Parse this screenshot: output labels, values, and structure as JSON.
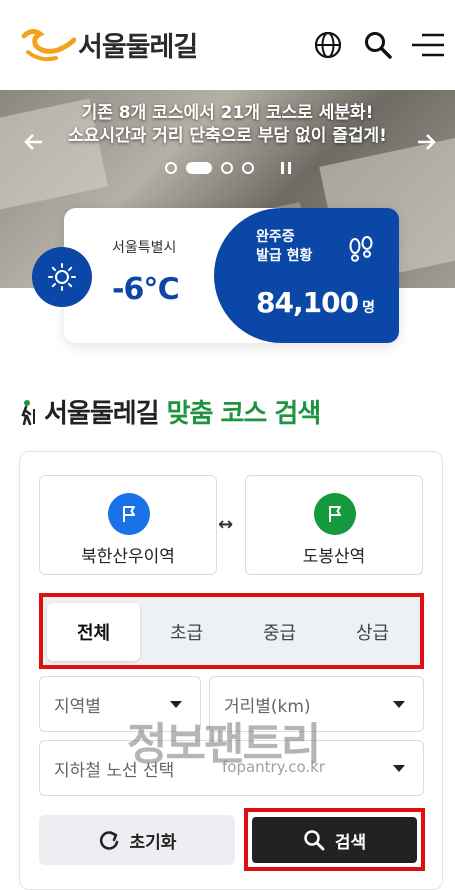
{
  "header": {
    "logo_text": "서울둘레길",
    "icons": [
      "globe-icon",
      "search-icon",
      "menu-icon"
    ]
  },
  "hero": {
    "line1": "기존 8개 코스에서 21개 코스로 세분화!",
    "line2": "소요시간과 거리 단축으로 부담 없이 즐겁게!",
    "slides": 4,
    "active_slide": 2
  },
  "weather": {
    "city": "서울특별시",
    "temperature": "-6℃",
    "icon": "sun-icon"
  },
  "certificate": {
    "label_line1": "완주증",
    "label_line2": "발급 현황",
    "count": "84,100",
    "unit": "명",
    "icon": "footprints-icon"
  },
  "search": {
    "title_main": "서울둘레길",
    "title_accent": "맞춤 코스 검색",
    "start_station": "북한산우이역",
    "end_station": "도봉산역",
    "swap_symbol": "↔",
    "tabs": [
      {
        "label": "전체",
        "active": true
      },
      {
        "label": "초급",
        "active": false
      },
      {
        "label": "중급",
        "active": false
      },
      {
        "label": "상급",
        "active": false
      }
    ],
    "region_select": "지역별",
    "distance_select": "거리별(km)",
    "subway_select": "지하철 노선 선택",
    "reset_label": "초기화",
    "search_label": "검색"
  },
  "watermark": {
    "text": "정보팬트리",
    "sub": "fopantry.co.kr"
  },
  "colors": {
    "brand_blue": "#0a47a6",
    "brand_green": "#1e9440",
    "highlight_red": "#e01010",
    "logo_orange": "#f5a21b"
  }
}
